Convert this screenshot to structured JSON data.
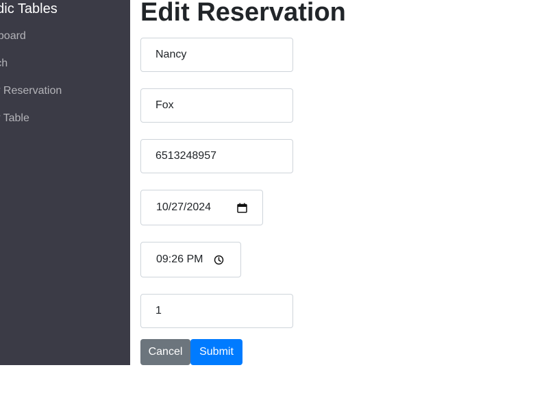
{
  "sidebar": {
    "brand": "odic Tables",
    "items": [
      {
        "label": "shboard"
      },
      {
        "label": "arch"
      },
      {
        "label": "ew Reservation"
      },
      {
        "label": "ew Table"
      }
    ]
  },
  "main": {
    "title": "Edit Reservation"
  },
  "form": {
    "first_name": "Nancy",
    "last_name": "Fox",
    "mobile_number": "6513248957",
    "reservation_date": "10/27/2024",
    "reservation_time": "09:26 PM",
    "people": "1",
    "date_icon": "calendar-icon",
    "time_icon": "clock-icon"
  },
  "buttons": {
    "cancel_label": "Cancel",
    "submit_label": "Submit"
  },
  "colors": {
    "sidebar_bg": "#3b3b46",
    "cancel_bg": "#6c757d",
    "submit_bg": "#007bff"
  }
}
